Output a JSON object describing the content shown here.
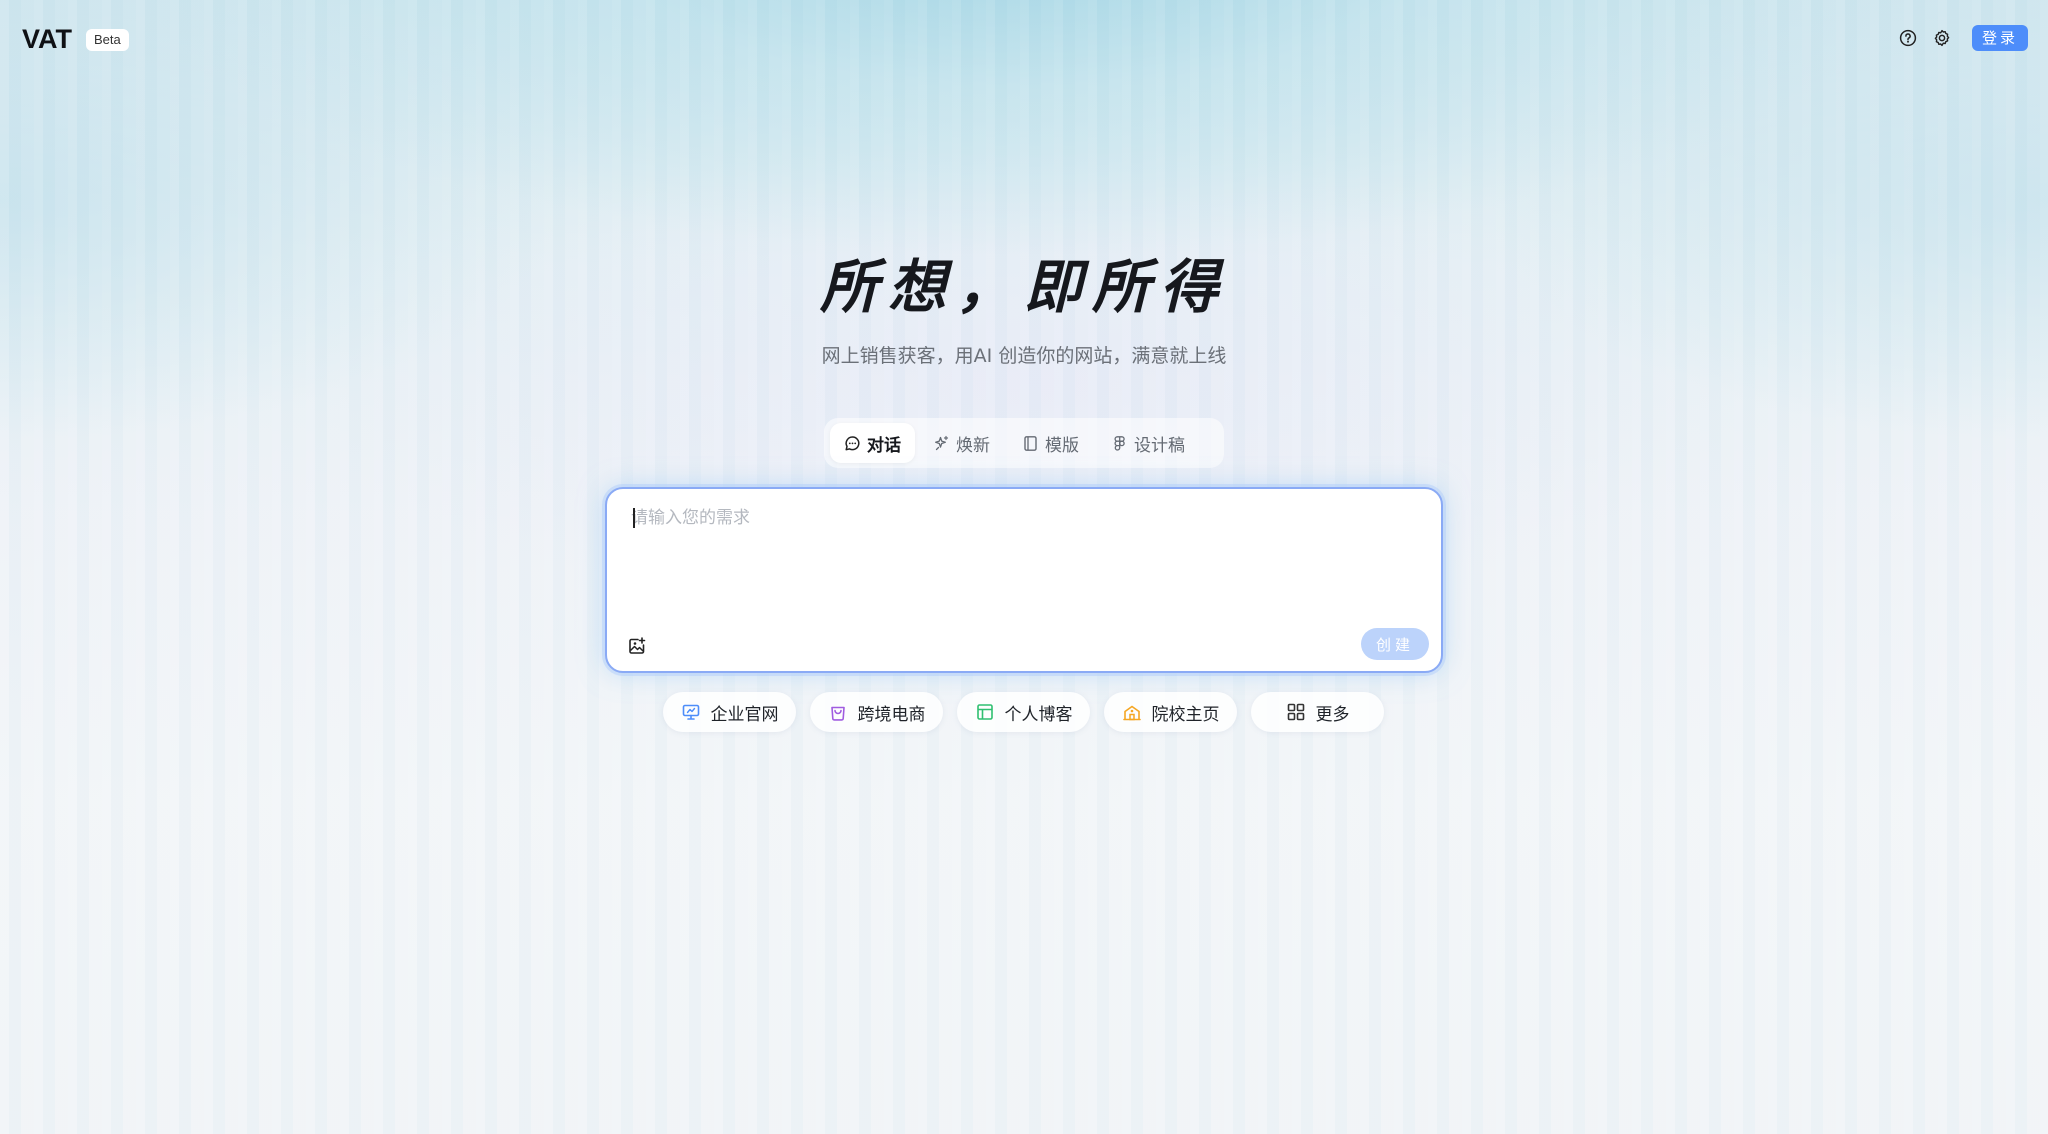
{
  "header": {
    "logo": "VAT",
    "badge": "Beta",
    "login_label": "登录",
    "accent_color": "#4d8dfa"
  },
  "icons": {
    "help": "question-circle-icon",
    "settings": "gear-icon"
  },
  "hero": {
    "title": "所想，即所得",
    "subtitle": "网上销售获客，用AI 创造你的网站，满意就上线"
  },
  "mode_tabs": [
    {
      "label": "对话",
      "icon": "chat-bubble-icon",
      "active": true
    },
    {
      "label": "焕新",
      "icon": "sparkle-icon",
      "active": false
    },
    {
      "label": "模版",
      "icon": "template-icon",
      "active": false
    },
    {
      "label": "设计稿",
      "icon": "figma-icon",
      "active": false
    }
  ],
  "prompt": {
    "placeholder": "请输入您的需求",
    "value": "",
    "create_label": "创建"
  },
  "quick_chips": [
    {
      "label": "企业官网",
      "icon": "monitor-icon",
      "color": "#4d8dfa"
    },
    {
      "label": "跨境电商",
      "icon": "shopping-bag-icon",
      "color": "#a05ce0"
    },
    {
      "label": "个人博客",
      "icon": "layout-icon",
      "color": "#2fbf71"
    },
    {
      "label": "院校主页",
      "icon": "school-icon",
      "color": "#f5a623"
    },
    {
      "label": "更多",
      "icon": "grid-icon",
      "color": "#333333"
    }
  ]
}
